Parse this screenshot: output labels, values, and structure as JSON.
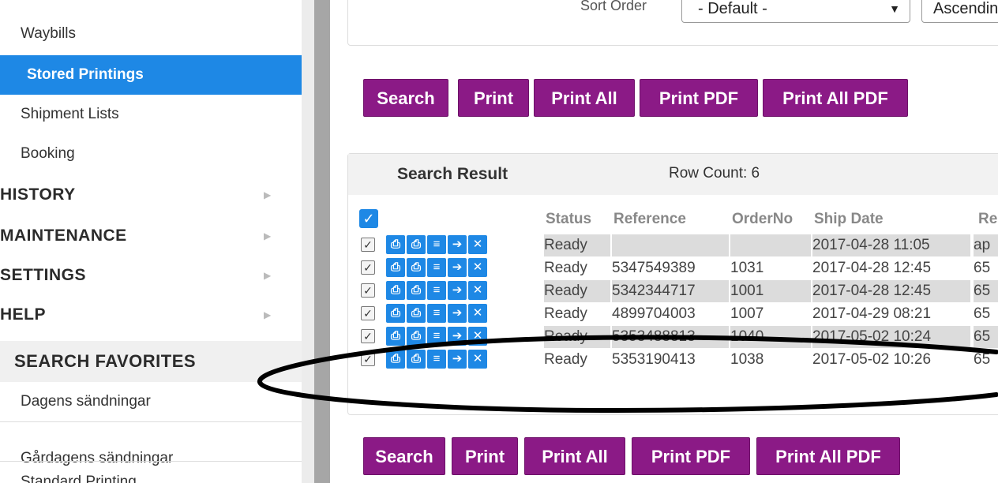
{
  "sidebar": {
    "items": [
      {
        "label": "Waybills"
      },
      {
        "label": "Stored Printings"
      },
      {
        "label": "Shipment Lists"
      },
      {
        "label": "Booking"
      }
    ],
    "sections": [
      {
        "label": "HISTORY"
      },
      {
        "label": "MAINTENANCE"
      },
      {
        "label": "SETTINGS"
      },
      {
        "label": "HELP"
      }
    ],
    "favorites_header": "SEARCH FAVORITES",
    "favorites": [
      {
        "label": "Dagens sändningar"
      },
      {
        "label": "Gårdagens sändningar"
      },
      {
        "label": "Standard Printing"
      }
    ],
    "arrow_glyph": "▶"
  },
  "filter": {
    "sort_label": "Sort Order",
    "sort_value": "- Default -",
    "sort_caret": "▼",
    "direction_value": "Ascending"
  },
  "buttons": {
    "search": "Search",
    "print": "Print",
    "print_all": "Print All",
    "print_pdf": "Print PDF",
    "print_all_pdf": "Print All PDF"
  },
  "results": {
    "title": "Search Result",
    "row_count": "Row Count: 6",
    "columns": [
      "Status",
      "Reference",
      "OrderNo",
      "Ship Date",
      "Re"
    ],
    "rows": [
      {
        "status": "Ready",
        "reference": "",
        "order": "",
        "date": "2017-04-28 11:05",
        "r": "ap"
      },
      {
        "status": "Ready",
        "reference": "5347549389",
        "order": "1031",
        "date": "2017-04-28 12:45",
        "r": "65"
      },
      {
        "status": "Ready",
        "reference": "5342344717",
        "order": "1001",
        "date": "2017-04-28 12:45",
        "r": "65"
      },
      {
        "status": "Ready",
        "reference": "4899704003",
        "order": "1007",
        "date": "2017-04-29 08:21",
        "r": "65"
      },
      {
        "status": "Ready",
        "reference": "5353488813",
        "order": "1040",
        "date": "2017-05-02 10:24",
        "r": "65"
      },
      {
        "status": "Ready",
        "reference": "5353190413",
        "order": "1038",
        "date": "2017-05-02 10:26",
        "r": "65"
      }
    ]
  },
  "icons": [
    "printer-icon",
    "printer-alt-icon",
    "list-icon",
    "arrow-right-icon",
    "close-icon"
  ],
  "colors": {
    "accent_blue": "#1e88e5",
    "button_purple": "#8b1a86",
    "annotation_ink": "#000000"
  }
}
